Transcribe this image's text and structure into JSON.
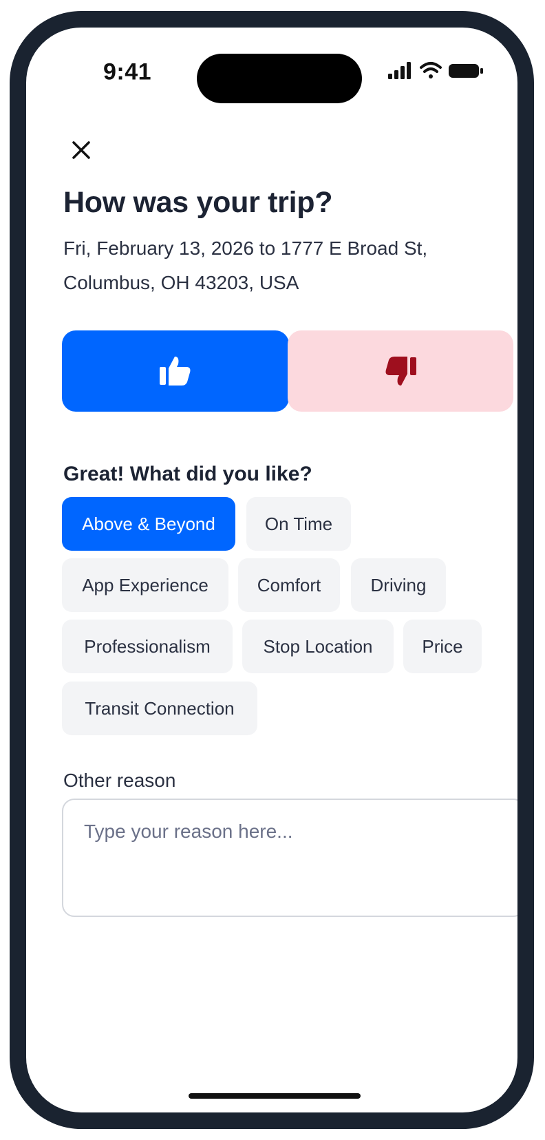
{
  "status_bar": {
    "time": "9:41",
    "icons": [
      "cellular-signal-icon",
      "wifi-icon",
      "battery-icon"
    ]
  },
  "header": {
    "close_icon": "close-icon",
    "title": "How was your trip?",
    "subtitle": "Fri, February 13, 2026 to 1777 E Broad St, Columbus, OH 43203, USA"
  },
  "rating": {
    "selected": "thumbs-up",
    "thumbs_up": {
      "icon": "thumbs-up-icon",
      "color": "#0066ff"
    },
    "thumbs_down": {
      "icon": "thumbs-down-icon",
      "color": "#fcd9de",
      "icon_color": "#9e0f1e"
    }
  },
  "feedback": {
    "heading": "Great! What did you like?",
    "chips": [
      {
        "label": "Above & Beyond",
        "selected": true
      },
      {
        "label": "On Time",
        "selected": false
      },
      {
        "label": "App Experience",
        "selected": false
      },
      {
        "label": "Comfort",
        "selected": false
      },
      {
        "label": "Driving",
        "selected": false
      },
      {
        "label": "Professionalism",
        "selected": false
      },
      {
        "label": "Stop Location",
        "selected": false
      },
      {
        "label": "Price",
        "selected": false
      },
      {
        "label": "Transit Connection",
        "selected": false
      }
    ]
  },
  "other_reason": {
    "label": "Other reason",
    "placeholder": "Type your reason here...",
    "value": ""
  },
  "colors": {
    "accent": "#0066ff",
    "chip_bg": "#f3f4f6",
    "dislike_bg": "#fcd9de",
    "dislike_icon": "#9e0f1e",
    "frame": "#1a2330"
  }
}
